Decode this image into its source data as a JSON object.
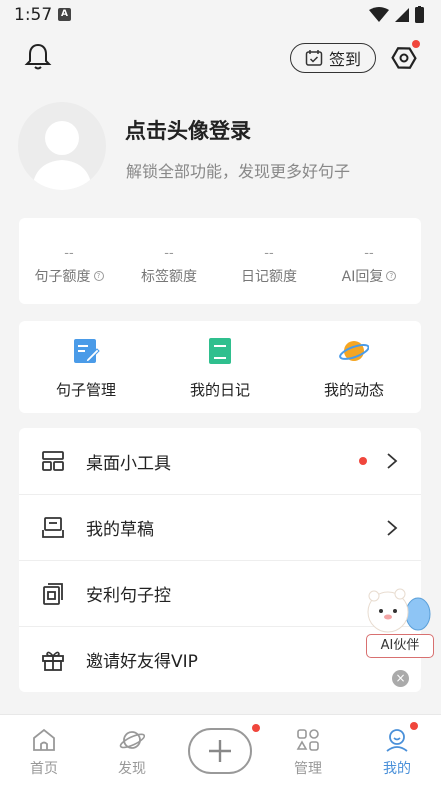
{
  "status_bar": {
    "time": "1:57",
    "notif_letter": "A"
  },
  "header": {
    "signin_label": "签到"
  },
  "profile": {
    "title": "点击头像登录",
    "subtitle": "解锁全部功能，发现更多好句子"
  },
  "quota": [
    {
      "value": "--",
      "label": "句子额度",
      "help": true
    },
    {
      "value": "--",
      "label": "标签额度",
      "help": false
    },
    {
      "value": "--",
      "label": "日记额度",
      "help": false
    },
    {
      "value": "--",
      "label": "AI回复",
      "help": true
    }
  ],
  "shortcuts": [
    {
      "label": "句子管理",
      "icon": "edit-note-icon"
    },
    {
      "label": "我的日记",
      "icon": "diary-book-icon"
    },
    {
      "label": "我的动态",
      "icon": "planet-icon"
    }
  ],
  "menu": [
    {
      "label": "桌面小工具",
      "icon": "widget-icon",
      "badge": true
    },
    {
      "label": "我的草稿",
      "icon": "draft-icon",
      "badge": false
    },
    {
      "label": "安利句子控",
      "icon": "share-app-icon",
      "badge": false
    },
    {
      "label": "邀请好友得VIP",
      "icon": "gift-icon",
      "badge": false
    }
  ],
  "ai_assistant": {
    "label": "AI伙伴",
    "close": "×"
  },
  "bottom_nav": [
    {
      "label": "首页",
      "icon": "home-icon"
    },
    {
      "label": "发现",
      "icon": "discover-planet-icon"
    },
    {
      "label": "管理",
      "icon": "manage-grid-icon"
    },
    {
      "label": "我的",
      "icon": "profile-icon",
      "active": true
    }
  ],
  "colors": {
    "accent": "#4a90d9",
    "badge": "#f0463c",
    "background": "#f4f4f4"
  }
}
